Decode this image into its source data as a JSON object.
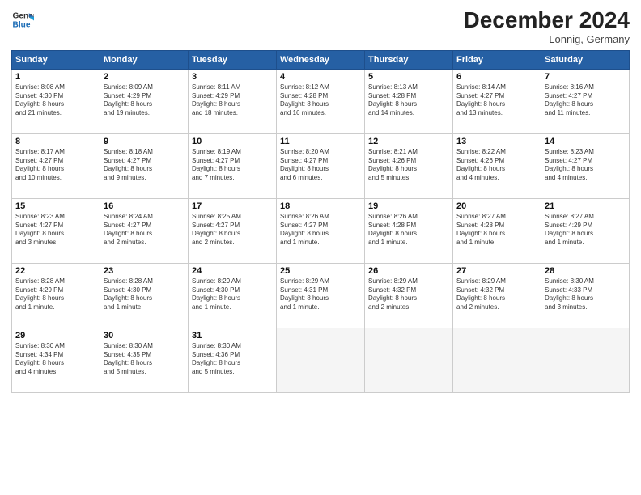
{
  "header": {
    "logo_line1": "General",
    "logo_line2": "Blue",
    "month": "December 2024",
    "location": "Lonnig, Germany"
  },
  "days_of_week": [
    "Sunday",
    "Monday",
    "Tuesday",
    "Wednesday",
    "Thursday",
    "Friday",
    "Saturday"
  ],
  "weeks": [
    [
      {
        "day": 1,
        "lines": [
          "Sunrise: 8:08 AM",
          "Sunset: 4:30 PM",
          "Daylight: 8 hours",
          "and 21 minutes."
        ]
      },
      {
        "day": 2,
        "lines": [
          "Sunrise: 8:09 AM",
          "Sunset: 4:29 PM",
          "Daylight: 8 hours",
          "and 19 minutes."
        ]
      },
      {
        "day": 3,
        "lines": [
          "Sunrise: 8:11 AM",
          "Sunset: 4:29 PM",
          "Daylight: 8 hours",
          "and 18 minutes."
        ]
      },
      {
        "day": 4,
        "lines": [
          "Sunrise: 8:12 AM",
          "Sunset: 4:28 PM",
          "Daylight: 8 hours",
          "and 16 minutes."
        ]
      },
      {
        "day": 5,
        "lines": [
          "Sunrise: 8:13 AM",
          "Sunset: 4:28 PM",
          "Daylight: 8 hours",
          "and 14 minutes."
        ]
      },
      {
        "day": 6,
        "lines": [
          "Sunrise: 8:14 AM",
          "Sunset: 4:27 PM",
          "Daylight: 8 hours",
          "and 13 minutes."
        ]
      },
      {
        "day": 7,
        "lines": [
          "Sunrise: 8:16 AM",
          "Sunset: 4:27 PM",
          "Daylight: 8 hours",
          "and 11 minutes."
        ]
      }
    ],
    [
      {
        "day": 8,
        "lines": [
          "Sunrise: 8:17 AM",
          "Sunset: 4:27 PM",
          "Daylight: 8 hours",
          "and 10 minutes."
        ]
      },
      {
        "day": 9,
        "lines": [
          "Sunrise: 8:18 AM",
          "Sunset: 4:27 PM",
          "Daylight: 8 hours",
          "and 9 minutes."
        ]
      },
      {
        "day": 10,
        "lines": [
          "Sunrise: 8:19 AM",
          "Sunset: 4:27 PM",
          "Daylight: 8 hours",
          "and 7 minutes."
        ]
      },
      {
        "day": 11,
        "lines": [
          "Sunrise: 8:20 AM",
          "Sunset: 4:27 PM",
          "Daylight: 8 hours",
          "and 6 minutes."
        ]
      },
      {
        "day": 12,
        "lines": [
          "Sunrise: 8:21 AM",
          "Sunset: 4:26 PM",
          "Daylight: 8 hours",
          "and 5 minutes."
        ]
      },
      {
        "day": 13,
        "lines": [
          "Sunrise: 8:22 AM",
          "Sunset: 4:26 PM",
          "Daylight: 8 hours",
          "and 4 minutes."
        ]
      },
      {
        "day": 14,
        "lines": [
          "Sunrise: 8:23 AM",
          "Sunset: 4:27 PM",
          "Daylight: 8 hours",
          "and 4 minutes."
        ]
      }
    ],
    [
      {
        "day": 15,
        "lines": [
          "Sunrise: 8:23 AM",
          "Sunset: 4:27 PM",
          "Daylight: 8 hours",
          "and 3 minutes."
        ]
      },
      {
        "day": 16,
        "lines": [
          "Sunrise: 8:24 AM",
          "Sunset: 4:27 PM",
          "Daylight: 8 hours",
          "and 2 minutes."
        ]
      },
      {
        "day": 17,
        "lines": [
          "Sunrise: 8:25 AM",
          "Sunset: 4:27 PM",
          "Daylight: 8 hours",
          "and 2 minutes."
        ]
      },
      {
        "day": 18,
        "lines": [
          "Sunrise: 8:26 AM",
          "Sunset: 4:27 PM",
          "Daylight: 8 hours",
          "and 1 minute."
        ]
      },
      {
        "day": 19,
        "lines": [
          "Sunrise: 8:26 AM",
          "Sunset: 4:28 PM",
          "Daylight: 8 hours",
          "and 1 minute."
        ]
      },
      {
        "day": 20,
        "lines": [
          "Sunrise: 8:27 AM",
          "Sunset: 4:28 PM",
          "Daylight: 8 hours",
          "and 1 minute."
        ]
      },
      {
        "day": 21,
        "lines": [
          "Sunrise: 8:27 AM",
          "Sunset: 4:29 PM",
          "Daylight: 8 hours",
          "and 1 minute."
        ]
      }
    ],
    [
      {
        "day": 22,
        "lines": [
          "Sunrise: 8:28 AM",
          "Sunset: 4:29 PM",
          "Daylight: 8 hours",
          "and 1 minute."
        ]
      },
      {
        "day": 23,
        "lines": [
          "Sunrise: 8:28 AM",
          "Sunset: 4:30 PM",
          "Daylight: 8 hours",
          "and 1 minute."
        ]
      },
      {
        "day": 24,
        "lines": [
          "Sunrise: 8:29 AM",
          "Sunset: 4:30 PM",
          "Daylight: 8 hours",
          "and 1 minute."
        ]
      },
      {
        "day": 25,
        "lines": [
          "Sunrise: 8:29 AM",
          "Sunset: 4:31 PM",
          "Daylight: 8 hours",
          "and 1 minute."
        ]
      },
      {
        "day": 26,
        "lines": [
          "Sunrise: 8:29 AM",
          "Sunset: 4:32 PM",
          "Daylight: 8 hours",
          "and 2 minutes."
        ]
      },
      {
        "day": 27,
        "lines": [
          "Sunrise: 8:29 AM",
          "Sunset: 4:32 PM",
          "Daylight: 8 hours",
          "and 2 minutes."
        ]
      },
      {
        "day": 28,
        "lines": [
          "Sunrise: 8:30 AM",
          "Sunset: 4:33 PM",
          "Daylight: 8 hours",
          "and 3 minutes."
        ]
      }
    ],
    [
      {
        "day": 29,
        "lines": [
          "Sunrise: 8:30 AM",
          "Sunset: 4:34 PM",
          "Daylight: 8 hours",
          "and 4 minutes."
        ]
      },
      {
        "day": 30,
        "lines": [
          "Sunrise: 8:30 AM",
          "Sunset: 4:35 PM",
          "Daylight: 8 hours",
          "and 5 minutes."
        ]
      },
      {
        "day": 31,
        "lines": [
          "Sunrise: 8:30 AM",
          "Sunset: 4:36 PM",
          "Daylight: 8 hours",
          "and 5 minutes."
        ]
      },
      null,
      null,
      null,
      null
    ]
  ]
}
